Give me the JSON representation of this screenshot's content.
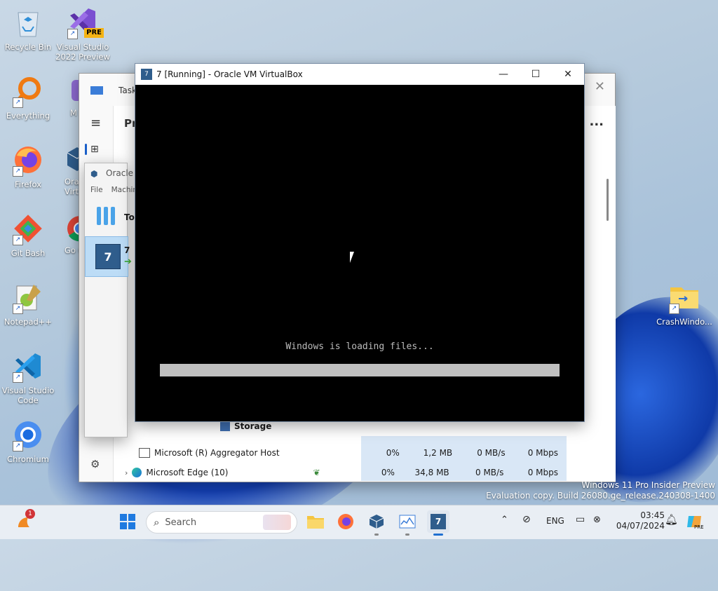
{
  "desktop": {
    "icons": [
      {
        "label": "Recycle Bin"
      },
      {
        "label": "Visual Studio 2022 Preview"
      },
      {
        "label": "Everything"
      },
      {
        "label": "M"
      },
      {
        "label": "Firefox"
      },
      {
        "label": "Orac Virtu"
      },
      {
        "label": "Git Bash"
      },
      {
        "label": "Go Ch"
      },
      {
        "label": "Notepad++"
      },
      {
        "label": "Visual Studio Code"
      },
      {
        "label": "Chromium"
      },
      {
        "label": "CrashWindo..."
      }
    ],
    "watermark": {
      "line1": "Windows 11 Pro Insider Preview",
      "line2": "Evaluation copy. Build 26080.ge_release.240308-1400"
    },
    "badge_pre": "PRE"
  },
  "task_manager": {
    "title": "Task",
    "heading": "Pro",
    "menu_more": "...",
    "storage_label": "Storage",
    "rows": [
      {
        "name": "Microsoft (R) Aggregator Host",
        "cpu": "0%",
        "memory": "1,2 MB",
        "disk": "0 MB/s",
        "network": "0 Mbps"
      },
      {
        "name": "Microsoft Edge (10)",
        "cpu": "0%",
        "memory": "34,8 MB",
        "disk": "0 MB/s",
        "network": "0 Mbps"
      }
    ]
  },
  "virtualbox_manager": {
    "title": "Oracle V",
    "menu": [
      "File",
      "Machin"
    ],
    "tools_label": "To",
    "vm_label": "7"
  },
  "vm_window": {
    "title": "7 [Running] - Oracle VM VirtualBox",
    "loading_text": "Windows is loading files...",
    "progress": 1.0
  },
  "taskbar": {
    "search_placeholder": "Search",
    "notification_count": "1",
    "language": "ENG",
    "time": "03:45",
    "date": "04/07/2024"
  }
}
